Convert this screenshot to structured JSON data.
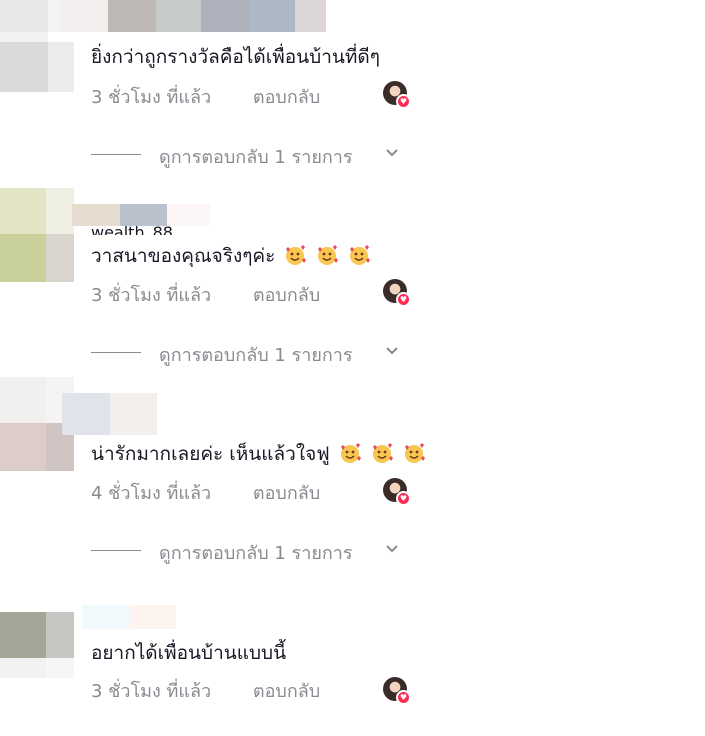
{
  "comments": [
    {
      "text": "ยิ่งกว่าถูกรางวัลคือได้เพื่อนบ้านที่ดีๆ",
      "time": "3 ชั่วโมง ที่แล้ว",
      "reply_label": "ตอบกลับ",
      "view_replies": "ดูการตอบกลับ 1 รายการ",
      "emojis": 0
    },
    {
      "username_partial": "wealth_88",
      "text": "วาสนาของคุณจริงๆค่ะ",
      "time": "3 ชั่วโมง ที่แล้ว",
      "reply_label": "ตอบกลับ",
      "view_replies": "ดูการตอบกลับ 1 รายการ",
      "emojis": 3
    },
    {
      "text": "น่ารักมากเลยค่ะ เห็นแล้วใจฟู",
      "time": "4 ชั่วโมง ที่แล้ว",
      "reply_label": "ตอบกลับ",
      "view_replies": "ดูการตอบกลับ 1 รายการ",
      "emojis": 3
    },
    {
      "text": "อยากได้เพื่อนบ้านแบบนี้",
      "time": "3 ชั่วโมง ที่แล้ว",
      "reply_label": "ตอบกลับ",
      "emojis": 0
    }
  ],
  "icons": {
    "emoji": "smiling-face-with-hearts-icon",
    "creator_like": "creator-liked-heart-icon",
    "chevron": "chevron-down-icon"
  },
  "colors": {
    "text_primary": "#161823",
    "text_secondary": "#8a8b91",
    "like_red": "#fe2c55"
  }
}
